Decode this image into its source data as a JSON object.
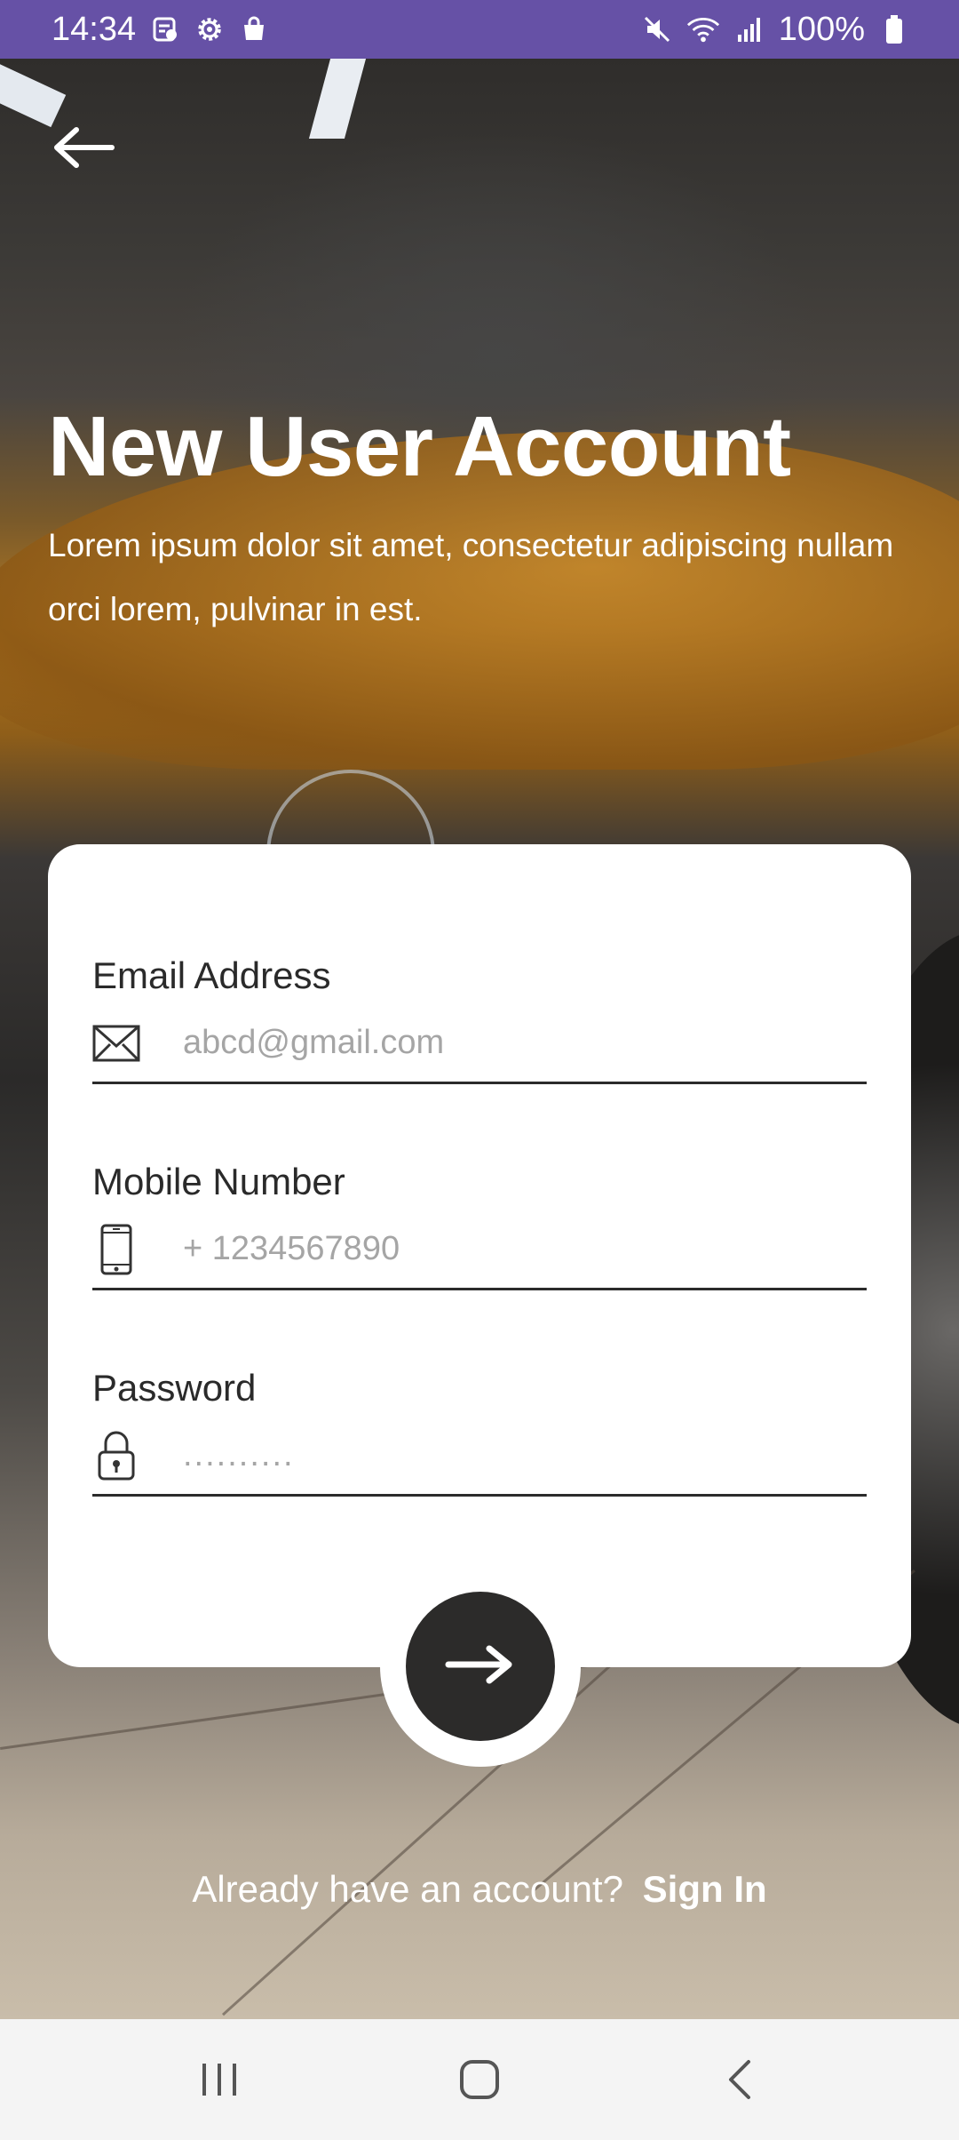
{
  "status_bar": {
    "time": "14:34",
    "battery": "100%",
    "left_icons": [
      "notes-icon",
      "settings-gear-icon",
      "shopping-bag-icon"
    ],
    "right_icons": [
      "mute-icon",
      "wifi-icon",
      "signal-icon",
      "battery-icon"
    ]
  },
  "header": {
    "title": "New User Account",
    "subtitle": "Lorem ipsum dolor sit amet, consectetur adipiscing nullam orci lorem, pulvinar in est."
  },
  "form": {
    "email": {
      "label": "Email Address",
      "placeholder": "abcd@gmail.com",
      "icon": "mail-icon"
    },
    "mobile": {
      "label": "Mobile Number",
      "placeholder": "+ 1234567890",
      "icon": "phone-icon"
    },
    "password": {
      "label": "Password",
      "placeholder": "..........",
      "icon": "lock-icon"
    },
    "submit_icon": "arrow-right-icon"
  },
  "footer": {
    "prompt": "Already have an account?",
    "signin_label": "Sign In"
  },
  "nav_bar": [
    "recents-icon",
    "home-icon",
    "back-icon"
  ],
  "colors": {
    "status_bar": "#6651a6",
    "button": "#2c2b2a",
    "card": "#ffffff"
  }
}
